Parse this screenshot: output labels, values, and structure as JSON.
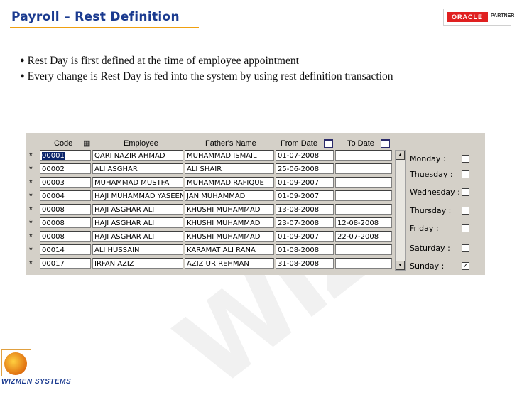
{
  "slide": {
    "title": "Payroll – Rest Definition",
    "oracle_brand": "ORACLE",
    "oracle_partner": "PARTNER",
    "bullets": [
      "Rest Day is first defined at the time of employee appointment",
      "Every change is Rest Day is fed into the system by using rest definition transaction"
    ],
    "footer_company": "WIZMEN SYSTEMS"
  },
  "form": {
    "headers": {
      "code": "Code",
      "employee": "Employee",
      "fathers_name": "Father's Name",
      "from_date": "From Date",
      "to_date": "To Date"
    },
    "rows": [
      {
        "marker": "*",
        "code": "00001",
        "employee": "QARI NAZIR AHMAD",
        "father": "MUHAMMAD ISMAIL",
        "from": "01-07-2008",
        "to": ""
      },
      {
        "marker": "*",
        "code": "00002",
        "employee": "ALI ASGHAR",
        "father": "ALI SHAIR",
        "from": "25-06-2008",
        "to": ""
      },
      {
        "marker": "*",
        "code": "00003",
        "employee": "MUHAMMAD MUSTFA",
        "father": "MUHAMMAD RAFIQUE",
        "from": "01-09-2007",
        "to": ""
      },
      {
        "marker": "*",
        "code": "00004",
        "employee": "HAJI MUHAMMAD YASEEN",
        "father": "JAN MUHAMMAD",
        "from": "01-09-2007",
        "to": ""
      },
      {
        "marker": "*",
        "code": "00008",
        "employee": "HAJI ASGHAR ALI",
        "father": "KHUSHI MUHAMMAD",
        "from": "13-08-2008",
        "to": ""
      },
      {
        "marker": "*",
        "code": "00008",
        "employee": "HAJI ASGHAR ALI",
        "father": "KHUSHI MUHAMMAD",
        "from": "23-07-2008",
        "to": "12-08-2008"
      },
      {
        "marker": "*",
        "code": "00008",
        "employee": "HAJI ASGHAR ALI",
        "father": "KHUSHI MUHAMMAD",
        "from": "01-09-2007",
        "to": "22-07-2008"
      },
      {
        "marker": "*",
        "code": "00014",
        "employee": "ALI HUSSAIN",
        "father": "KARAMAT ALI RANA",
        "from": "01-08-2008",
        "to": ""
      },
      {
        "marker": "*",
        "code": "00017",
        "employee": "IRFAN AZIZ",
        "father": "AZIZ UR REHMAN",
        "from": "31-08-2008",
        "to": ""
      }
    ],
    "rest_days": [
      {
        "label": "Monday :",
        "checked": false
      },
      {
        "label": "Thuesday :",
        "checked": false
      },
      {
        "label": "Wednesday :",
        "checked": false
      },
      {
        "label": "Thursday :",
        "checked": false
      },
      {
        "label": "Friday :",
        "checked": false
      },
      {
        "label": "Saturday :",
        "checked": false
      },
      {
        "label": "Sunday :",
        "checked": true
      }
    ],
    "scroll_up_glyph": "▲",
    "scroll_down_glyph": "▼",
    "check_glyph": "✓"
  },
  "colors": {
    "title": "#1a3a8f",
    "title_underline": "#f0a010",
    "form_bg": "#d4d0c8",
    "selection": "#0a246a"
  }
}
